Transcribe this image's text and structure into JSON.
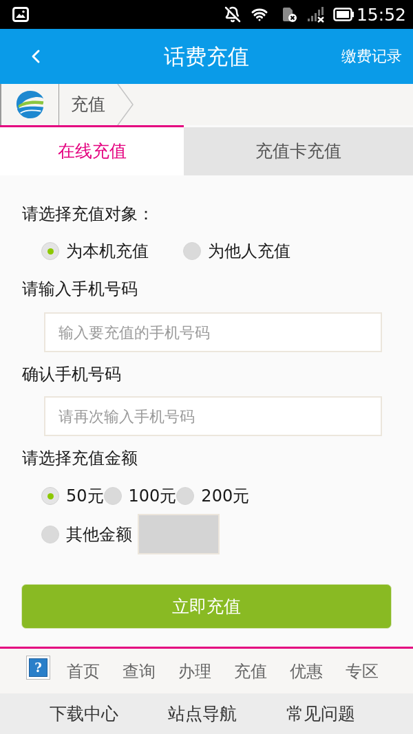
{
  "status_bar": {
    "time": "15:52"
  },
  "app_bar": {
    "title": "话费充值",
    "action": "缴费记录"
  },
  "breadcrumb": {
    "items": [
      "充值"
    ]
  },
  "tabs": [
    {
      "label": "在线充值",
      "selected": true
    },
    {
      "label": "充值卡充值",
      "selected": false
    }
  ],
  "form": {
    "target_label": "请选择充值对象：",
    "targets": [
      {
        "label": "为本机充值",
        "selected": true
      },
      {
        "label": "为他人充值",
        "selected": false
      }
    ],
    "phone_label": "请输入手机号码",
    "phone": {
      "placeholder": "输入要充值的手机号码"
    },
    "confirm_label": "确认手机号码",
    "confirm": {
      "placeholder": "请再次输入手机号码"
    },
    "amount_label": "请选择充值金额",
    "amounts": [
      {
        "kind": "preset",
        "label": "50元",
        "selected": true
      },
      {
        "kind": "preset",
        "label": "100元",
        "selected": false
      },
      {
        "kind": "preset",
        "label": "200元",
        "selected": false
      },
      {
        "kind": "custom",
        "label": "其他金额",
        "selected": false
      }
    ],
    "submit": "立即充值"
  },
  "footer_nav": {
    "help_glyph": "?",
    "items": [
      "首页",
      "查询",
      "办理",
      "充值",
      "优惠",
      "专区"
    ]
  },
  "footer_links": [
    "下载中心",
    "站点导航",
    "常见问题"
  ]
}
